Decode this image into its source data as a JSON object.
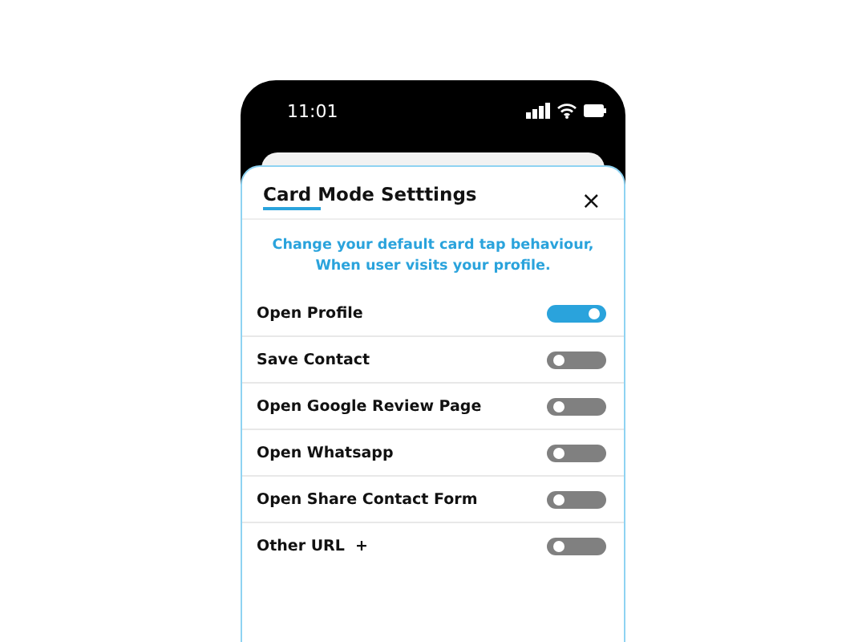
{
  "status_bar": {
    "time": "11:01"
  },
  "sheet": {
    "title": "Card Mode Setttings",
    "close": "×",
    "description": "Change your default card tap behaviour,\nWhen user visits your profile.",
    "options": [
      {
        "label": "Open Profile",
        "on": true
      },
      {
        "label": "Save Contact",
        "on": false
      },
      {
        "label": "Open Google Review Page",
        "on": false
      },
      {
        "label": "Open Whatsapp",
        "on": false
      },
      {
        "label": "Open Share Contact Form",
        "on": false
      },
      {
        "label": "Other URL  +",
        "on": false
      }
    ]
  }
}
